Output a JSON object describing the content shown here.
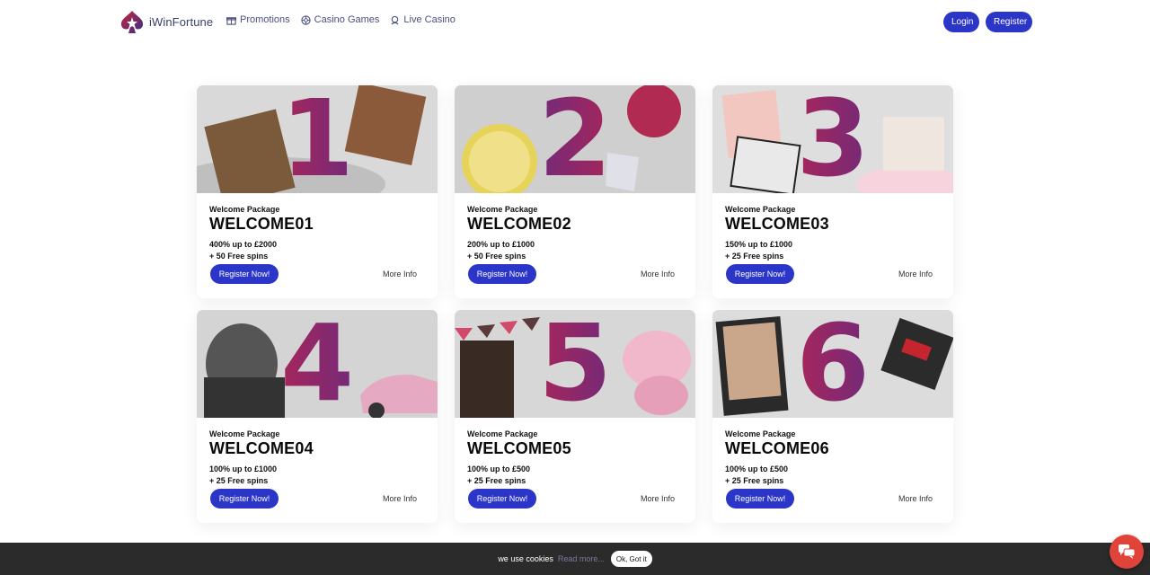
{
  "brand": {
    "name": "iWinFortune",
    "accent": "#2b36c9",
    "logo_red": "#c7243a"
  },
  "nav": [
    {
      "label": "Promotions",
      "icon": "gift-icon"
    },
    {
      "label": "Casino Games",
      "icon": "chip-icon"
    },
    {
      "label": "Live Casino",
      "icon": "dealer-icon"
    }
  ],
  "auth": {
    "login": "Login",
    "register": "Register"
  },
  "cards": [
    {
      "number": "1",
      "label": "Welcome Package",
      "code": "WELCOME01",
      "offer_line1": "400% up to £2000",
      "offer_line2": "+ 50 Free spins",
      "cta": "Register Now!",
      "more": "More Info"
    },
    {
      "number": "2",
      "label": "Welcome Package",
      "code": "WELCOME02",
      "offer_line1": "200% up to £1000",
      "offer_line2": "+ 50 Free spins",
      "cta": "Register Now!",
      "more": "More Info"
    },
    {
      "number": "3",
      "label": "Welcome Package",
      "code": "WELCOME03",
      "offer_line1": "150% up to £1000",
      "offer_line2": "+ 25 Free spins",
      "cta": "Register Now!",
      "more": "More Info"
    },
    {
      "number": "4",
      "label": "Welcome Package",
      "code": "WELCOME04",
      "offer_line1": "100% up to £1000",
      "offer_line2": "+ 25 Free spins",
      "cta": "Register Now!",
      "more": "More Info"
    },
    {
      "number": "5",
      "label": "Welcome Package",
      "code": "WELCOME05",
      "offer_line1": "100% up to £500",
      "offer_line2": "+ 25 Free spins",
      "cta": "Register Now!",
      "more": "More Info"
    },
    {
      "number": "6",
      "label": "Welcome Package",
      "code": "WELCOME06",
      "offer_line1": "100% up to £500",
      "offer_line2": "+ 25 Free spins",
      "cta": "Register Now!",
      "more": "More Info"
    }
  ],
  "cookie": {
    "text": "we use cookies",
    "link": "Read more...",
    "button": "Ok, Got it"
  },
  "chat": {
    "icon": "chat-icon",
    "color": "#e0433a"
  }
}
